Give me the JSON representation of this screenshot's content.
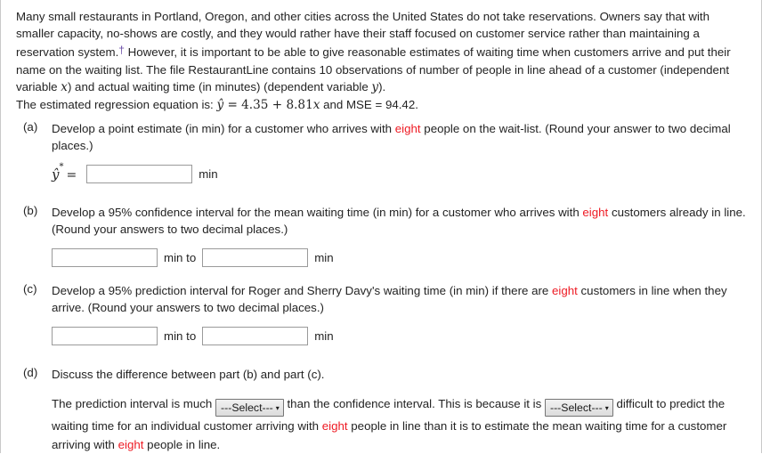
{
  "intro": {
    "text_1": "Many small restaurants in Portland, Oregon, and other cities across the United States do not take reservations. Owners say that with smaller capacity, no-shows are costly, and they would rather have their staff focused on customer service rather than maintaining a reservation system.",
    "footnote_marker": "†",
    "text_2": " However, it is important to be able to give reasonable estimates of waiting time when customers arrive and put their name on the waiting list. The file RestaurantLine contains 10 observations of number of people in line ahead of a customer (independent variable ",
    "var_x": "x",
    "text_3": ") and actual waiting time (in minutes) (dependent variable ",
    "var_y": "y",
    "text_4": ").",
    "equation_lead": "The estimated regression equation is: ",
    "equation_yhat": "ŷ",
    "equation_rhs": " = 4.35 + 8.81",
    "equation_x": "x",
    "equation_tail": " and MSE = 94.42."
  },
  "parts": {
    "a": {
      "label": "(a)",
      "text_1": "Develop a point estimate (in min) for a customer who arrives with ",
      "highlight": "eight",
      "text_2": " people on the wait-list. (Round your answer to two decimal places.)",
      "symbol": "ŷ",
      "symbol_sup": "*",
      "equals": "=",
      "input_value": "",
      "input_placeholder": "",
      "unit": "min"
    },
    "b": {
      "label": "(b)",
      "text_1": "Develop a 95% confidence interval for the mean waiting time (in min) for a customer who arrives with ",
      "highlight": "eight",
      "text_2": " customers already in line. (Round your answers to two decimal places.)",
      "lower_value": "",
      "upper_value": "",
      "unit_mid": "min to",
      "unit_end": "min"
    },
    "c": {
      "label": "(c)",
      "text_1": "Develop a 95% prediction interval for Roger and Sherry Davy's waiting time (in min) if there are ",
      "highlight": "eight",
      "text_2": " customers in line when they arrive. (Round your answers to two decimal places.)",
      "lower_value": "",
      "upper_value": "",
      "unit_mid": "min to",
      "unit_end": "min"
    },
    "d": {
      "label": "(d)",
      "prompt": "Discuss the difference between part (b) and part (c).",
      "sentence_1": "The prediction interval is much ",
      "select_1": "---Select---",
      "sentence_2": " than the confidence interval. This is because it is ",
      "select_2": "---Select---",
      "sentence_3": " difficult to predict the waiting time for an individual customer arriving with ",
      "highlight_1": "eight",
      "sentence_4": " people in line than it is to estimate the mean waiting time for a customer arriving with ",
      "highlight_2": "eight",
      "sentence_5": " people in line.",
      "caret": "▾"
    }
  },
  "colors": {
    "highlight": "#ee1b24",
    "footnote": "#6b4ea8",
    "text": "#232323",
    "border": "#9a9a9a"
  }
}
